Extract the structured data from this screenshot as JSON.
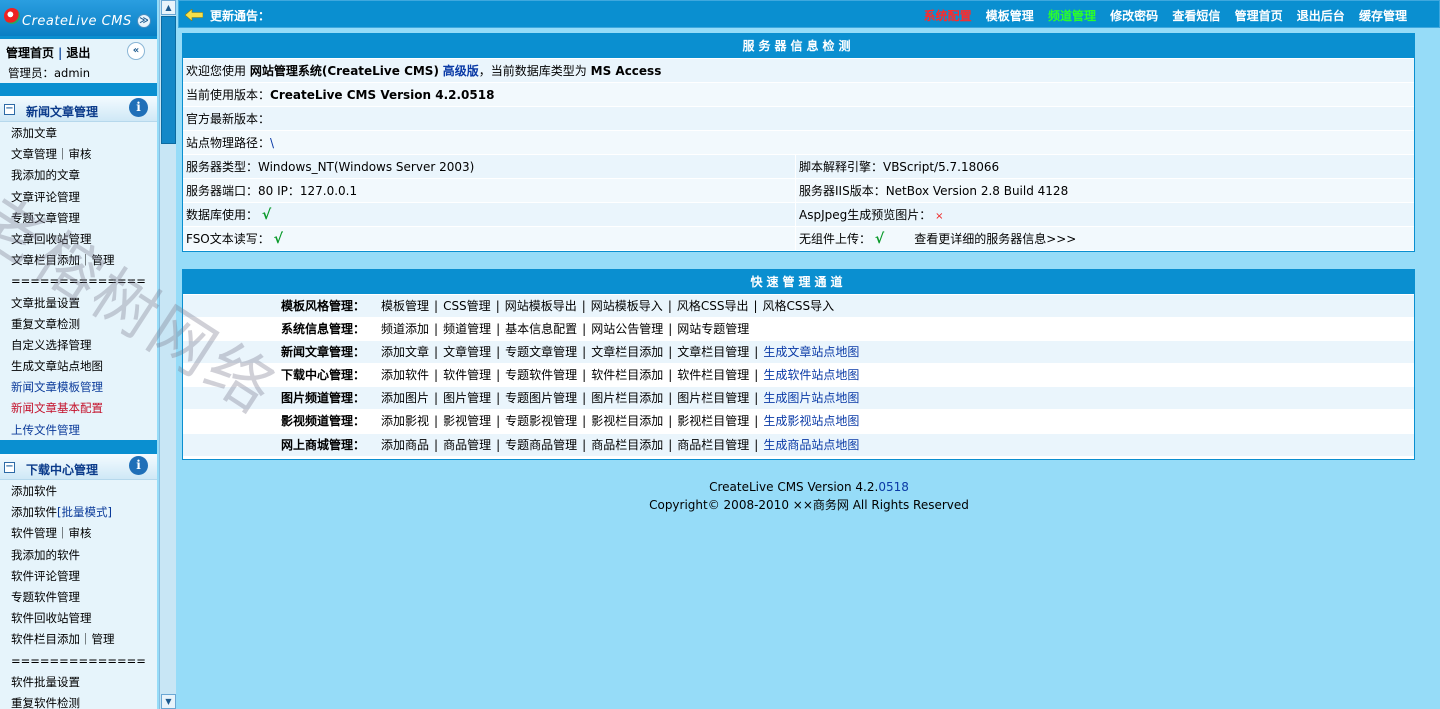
{
  "logo": {
    "text": "CreateLive CMS",
    "button": "≫"
  },
  "topbox": {
    "home": "管理首页",
    "separator": "|",
    "logout": "退出",
    "collapse": "«",
    "admin_label": "管理员：admin"
  },
  "sidebar": {
    "sections": [
      {
        "title": "新闻文章管理",
        "items": [
          "添加文章",
          "文章管理｜审核",
          "我添加的文章",
          "文章评论管理",
          "专题文章管理",
          "文章回收站管理",
          "文章栏目添加｜管理",
          "==============",
          "文章批量设置",
          "重复文章检测",
          "自定义选择管理",
          "生成文章站点地图",
          "新闻文章模板管理",
          "新闻文章基本配置",
          "上传文件管理"
        ]
      },
      {
        "title": "下载中心管理",
        "items": [
          "添加软件",
          "添加软件",
          "[批量模式]",
          "软件管理｜审核",
          "我添加的软件",
          "软件评论管理",
          "专题软件管理",
          "软件回收站管理",
          "软件栏目添加｜管理",
          "==============",
          "软件批量设置",
          "重复软件检测"
        ]
      }
    ]
  },
  "topbar": {
    "notice": "更新通告：",
    "nav": [
      "系统配置",
      "模板管理",
      "频道管理",
      "修改密码",
      "查看短信",
      "管理首页",
      "退出后台",
      "缓存管理"
    ]
  },
  "server": {
    "title": "服务器信息检测",
    "welcome_prefix": "欢迎您使用",
    "welcome_product": "网站管理系统(CreateLive CMS)",
    "welcome_edition": "高级版",
    "welcome_suffix": "，当前数据库类型为",
    "db_type": "MS Access",
    "version_label": "当前使用版本：",
    "version_value": "CreateLive CMS Version 4.2.0518",
    "latest_label": "官方最新版本：",
    "path_label": "站点物理路径：",
    "path_value": "\\",
    "server_type": "服务器类型：Windows_NT(Windows Server 2003)",
    "script_engine": "脚本解释引擎：VBScript/5.7.18066",
    "server_port": "服务器端口：80  IP：127.0.0.1",
    "iis_version": "服务器IIS版本：NetBox Version 2.8 Build 4128",
    "db_use_label": "数据库使用：",
    "aspjpeg_label": "AspJpeg生成预览图片：",
    "fso_label": "FSO文本读写：",
    "upload_label": "无组件上传：",
    "more_info": "查看更详细的服务器信息>>>",
    "check": "√",
    "cross": "×"
  },
  "quick": {
    "title": "快速管理通道",
    "rows": [
      {
        "label": "模板风格管理：",
        "links": [
          "模板管理",
          "CSS管理",
          "网站模板导出",
          "网站模板导入",
          "风格CSS导出",
          "风格CSS导入"
        ],
        "blue": ""
      },
      {
        "label": "系统信息管理：",
        "links": [
          "频道添加",
          "频道管理",
          "基本信息配置",
          "网站公告管理",
          "网站专题管理"
        ],
        "blue": ""
      },
      {
        "label": "新闻文章管理：",
        "links": [
          "添加文章",
          "文章管理",
          "专题文章管理",
          "文章栏目添加",
          "文章栏目管理"
        ],
        "blue": "生成文章站点地图"
      },
      {
        "label": "下载中心管理：",
        "links": [
          "添加软件",
          "软件管理",
          "专题软件管理",
          "软件栏目添加",
          "软件栏目管理"
        ],
        "blue": "生成软件站点地图"
      },
      {
        "label": "图片频道管理：",
        "links": [
          "添加图片",
          "图片管理",
          "专题图片管理",
          "图片栏目添加",
          "图片栏目管理"
        ],
        "blue": "生成图片站点地图"
      },
      {
        "label": "影视频道管理：",
        "links": [
          "添加影视",
          "影视管理",
          "专题影视管理",
          "影视栏目添加",
          "影视栏目管理"
        ],
        "blue": "生成影视站点地图"
      },
      {
        "label": "网上商城管理：",
        "links": [
          "添加商品",
          "商品管理",
          "专题商品管理",
          "商品栏目添加",
          "商品栏目管理"
        ],
        "blue": "生成商品站点地图"
      }
    ]
  },
  "footer": {
    "line1_prefix": "CreateLive CMS Version 4.2.",
    "line1_build": "0518",
    "line2": "Copyright© 2008-2010 ××商务网 All Rights Reserved"
  },
  "watermark": "老榕树网络",
  "colors": {
    "primary": "#0a8fd0",
    "background": "#96dcf8",
    "panel_row": "#eaf5fc",
    "red_link": "#ff2a2a",
    "green_link": "#2aff2a"
  }
}
